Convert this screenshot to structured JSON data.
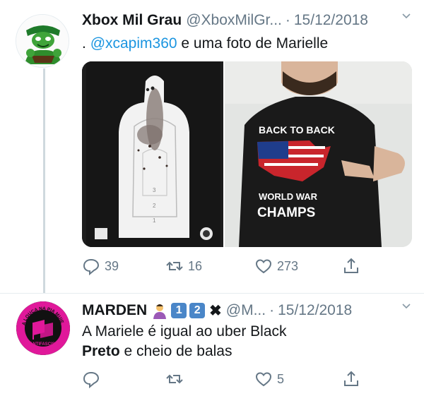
{
  "tweet1": {
    "name": "Xbox Mil Grau",
    "handle": "@XboxMilGr...",
    "separator": "·",
    "date": "15/12/2018",
    "text_prefix": ".",
    "mention": "@xcapim360",
    "text_rest": "e uma foto de Marielle",
    "shirt_text": [
      "BACK TO BACK",
      "WORLD WAR",
      "CHAMPS"
    ],
    "replies": "39",
    "retweets": "16",
    "likes": "273"
  },
  "tweet2": {
    "name": "MARDEN",
    "badge1": "1",
    "badge2": "2",
    "xmark": "✖",
    "handle": "@M...",
    "separator": "·",
    "date": "15/12/2018",
    "line1": "A Mariele é igual ao uber Black",
    "line2_bold": "Preto",
    "line2_rest": "e cheio de balas",
    "avatar_text": "A LOUCA NA PIA MUIE",
    "avatar_subtext": "ANTIFASCISTA",
    "likes": "5"
  },
  "colors": {
    "link": "#1b95e0",
    "muted": "#657786",
    "text": "#14171a",
    "antifa_pink": "#e0189a"
  },
  "icons": [
    "reply-icon",
    "retweet-icon",
    "like-icon",
    "share-icon",
    "chevron-down-icon"
  ]
}
